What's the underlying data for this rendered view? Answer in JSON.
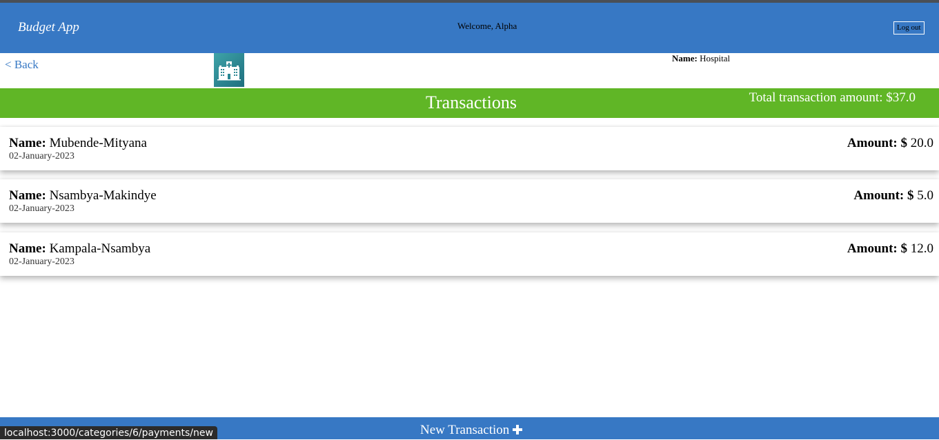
{
  "header": {
    "brand": "Budget App",
    "welcome": "Welcome, Alpha",
    "logout_label": "Log out"
  },
  "category": {
    "back_label": "< Back",
    "name_label": "Name:",
    "name": "Hospital",
    "icon": "hospital-icon"
  },
  "banner": {
    "title": "Transactions",
    "total": "Total transaction amount: $37.0"
  },
  "transactions": [
    {
      "name_label": "Name:",
      "name": "Mubende-Mityana",
      "date": "02-January-2023",
      "amount_label": "Amount: $",
      "amount": "20.0"
    },
    {
      "name_label": "Name:",
      "name": "Nsambya-Makindye",
      "date": "02-January-2023",
      "amount_label": "Amount: $",
      "amount": "5.0"
    },
    {
      "name_label": "Name:",
      "name": "Kampala-Nsambya",
      "date": "02-January-2023",
      "amount_label": "Amount: $",
      "amount": "12.0"
    }
  ],
  "footer": {
    "new_label": "New Transaction",
    "plus_icon": "plus-icon"
  },
  "status_bar": {
    "url": "localhost:3000/categories/6/payments/new"
  },
  "colors": {
    "header": "#3778c4",
    "banner": "#60b626",
    "link": "#3778c4"
  }
}
